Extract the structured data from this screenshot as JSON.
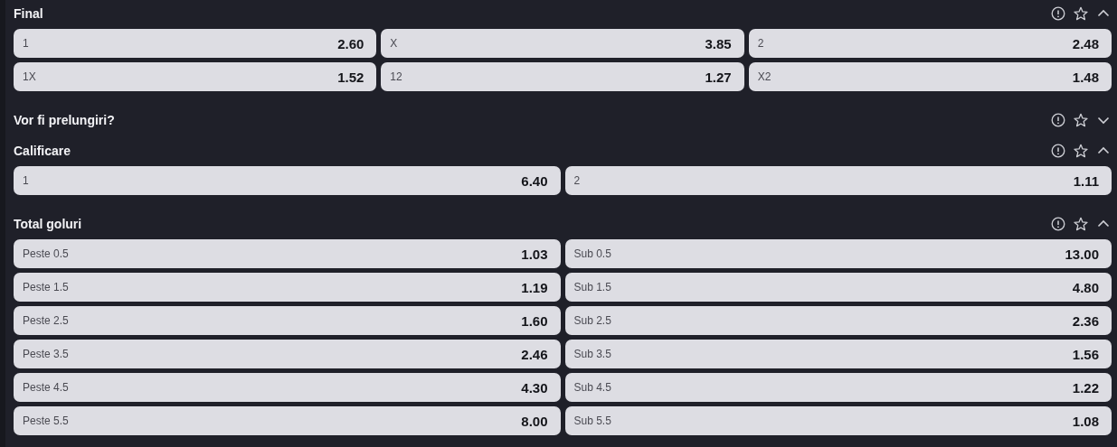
{
  "markets": [
    {
      "title": "Final",
      "expanded": true,
      "rows": [
        [
          {
            "label": "1",
            "odds": "2.60"
          },
          {
            "label": "X",
            "odds": "3.85"
          },
          {
            "label": "2",
            "odds": "2.48"
          }
        ],
        [
          {
            "label": "1X",
            "odds": "1.52"
          },
          {
            "label": "12",
            "odds": "1.27"
          },
          {
            "label": "X2",
            "odds": "1.48"
          }
        ]
      ]
    },
    {
      "title": "Vor fi prelungiri?",
      "expanded": false
    },
    {
      "title": "Calificare",
      "expanded": true,
      "rows": [
        [
          {
            "label": "1",
            "odds": "6.40"
          },
          {
            "label": "2",
            "odds": "1.11"
          }
        ]
      ]
    },
    {
      "title": "Total goluri",
      "expanded": true,
      "rows": [
        [
          {
            "label": "Peste 0.5",
            "odds": "1.03"
          },
          {
            "label": "Sub 0.5",
            "odds": "13.00"
          }
        ],
        [
          {
            "label": "Peste 1.5",
            "odds": "1.19"
          },
          {
            "label": "Sub 1.5",
            "odds": "4.80"
          }
        ],
        [
          {
            "label": "Peste 2.5",
            "odds": "1.60"
          },
          {
            "label": "Sub 2.5",
            "odds": "2.36"
          }
        ],
        [
          {
            "label": "Peste 3.5",
            "odds": "2.46"
          },
          {
            "label": "Sub 3.5",
            "odds": "1.56"
          }
        ],
        [
          {
            "label": "Peste 4.5",
            "odds": "4.30"
          },
          {
            "label": "Sub 4.5",
            "odds": "1.22"
          }
        ],
        [
          {
            "label": "Peste 5.5",
            "odds": "8.00"
          },
          {
            "label": "Sub 5.5",
            "odds": "1.08"
          }
        ]
      ]
    }
  ]
}
